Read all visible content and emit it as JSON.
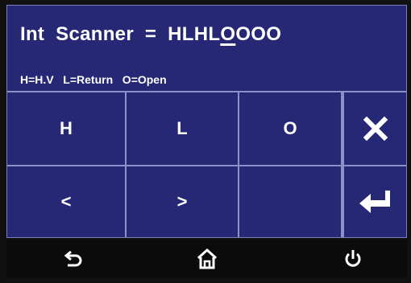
{
  "header": {
    "label": "Int  Scanner  =  ",
    "value_before_cursor": "HLHL",
    "value_cursor_char": "O",
    "value_after_cursor": "OOO"
  },
  "legend": "H=H.V   L=Return   O=Open",
  "keypad": {
    "keys": [
      "H",
      "L",
      "O",
      "<",
      ">",
      ""
    ]
  },
  "side_keys": {
    "top": "close-icon",
    "bottom": "enter-icon"
  },
  "navbar": {
    "icons": [
      "back-icon",
      "home-icon",
      "power-icon"
    ]
  },
  "colors": {
    "panel_bg": "#262876",
    "grid_lines": "#8d92c6",
    "text": "#ffffff",
    "navbar_bg": "#0b0b0b"
  }
}
